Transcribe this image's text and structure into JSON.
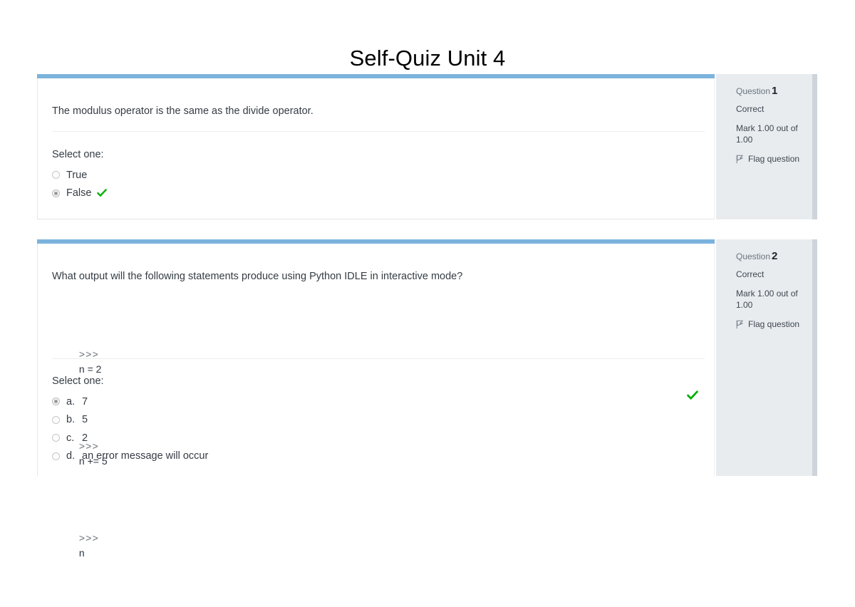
{
  "page": {
    "title": "Self-Quiz Unit 4"
  },
  "theme": {
    "accent_bar": "#7cb3dd",
    "sidebar_bg": "#e8ecef",
    "correct_check": "#00b000"
  },
  "questions": [
    {
      "prompt": "The modulus operator is the same as the divide operator.",
      "select_label": "Select one:",
      "code_lines": [],
      "options": [
        {
          "letter": "",
          "text": "True",
          "selected": false,
          "correct_mark": false
        },
        {
          "letter": "",
          "text": "False",
          "selected": true,
          "correct_mark": true
        }
      ],
      "info": {
        "question_label": "Question",
        "number": "1",
        "state": "Correct",
        "mark": "Mark 1.00 out of 1.00",
        "flag_label": "Flag question"
      }
    },
    {
      "prompt": "What output will the following statements produce using Python IDLE in interactive mode?",
      "select_label": "Select one:",
      "code_lines": [
        {
          "prompt": ">>>",
          "code": "n = 2"
        },
        {
          "prompt": ">>>",
          "code": "n += 5"
        },
        {
          "prompt": ">>>",
          "code": "n"
        }
      ],
      "options": [
        {
          "letter": "a.",
          "text": "7",
          "selected": true,
          "correct_mark": true
        },
        {
          "letter": "b.",
          "text": "5",
          "selected": false,
          "correct_mark": false
        },
        {
          "letter": "c.",
          "text": "2",
          "selected": false,
          "correct_mark": false
        },
        {
          "letter": "d.",
          "text": "an error message will occur",
          "selected": false,
          "correct_mark": false
        }
      ],
      "info": {
        "question_label": "Question",
        "number": "2",
        "state": "Correct",
        "mark": "Mark 1.00 out of 1.00",
        "flag_label": "Flag question"
      }
    }
  ]
}
